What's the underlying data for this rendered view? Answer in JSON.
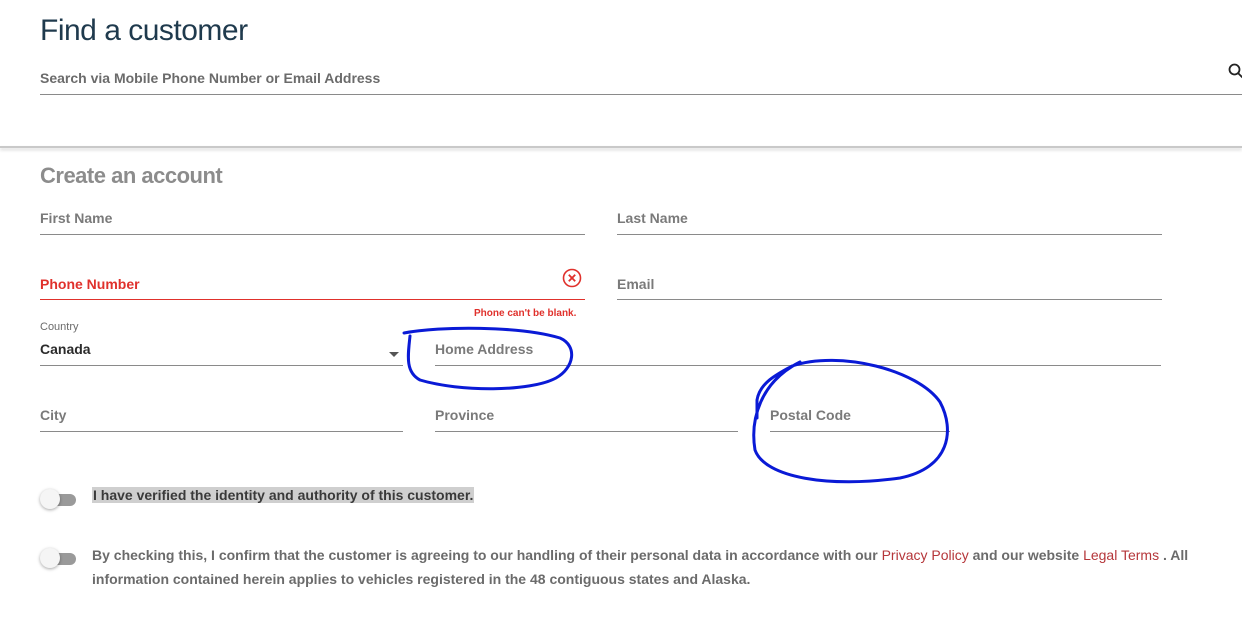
{
  "find": {
    "title": "Find a customer",
    "search_placeholder": "Search via Mobile Phone Number or Email Address",
    "search_icon": "search-icon"
  },
  "create": {
    "title": "Create an account",
    "first_name_label": "First Name",
    "last_name_label": "Last Name",
    "phone_label": "Phone Number",
    "phone_error": "Phone can't be blank.",
    "email_label": "Email",
    "country_label": "Country",
    "country_value": "Canada",
    "home_address_label": "Home Address",
    "city_label": "City",
    "province_label": "Province",
    "postal_code_label": "Postal Code"
  },
  "consent": {
    "verify_text": "I have verified the identity and authority of this customer.",
    "text_before": "By checking this, I confirm that the customer is agreeing to our handling of their personal data in accordance with our ",
    "privacy_link": "Privacy Policy",
    "text_middle": " and our website ",
    "legal_link": "Legal Terms",
    "text_after": " . All information contained herein applies to vehicles registered in the 48 contiguous states and Alaska."
  },
  "colors": {
    "title_blue": "#1f3a4d",
    "error_red": "#e0312c",
    "link_red": "#b5363a",
    "annotation_blue": "#0a1ad6"
  }
}
